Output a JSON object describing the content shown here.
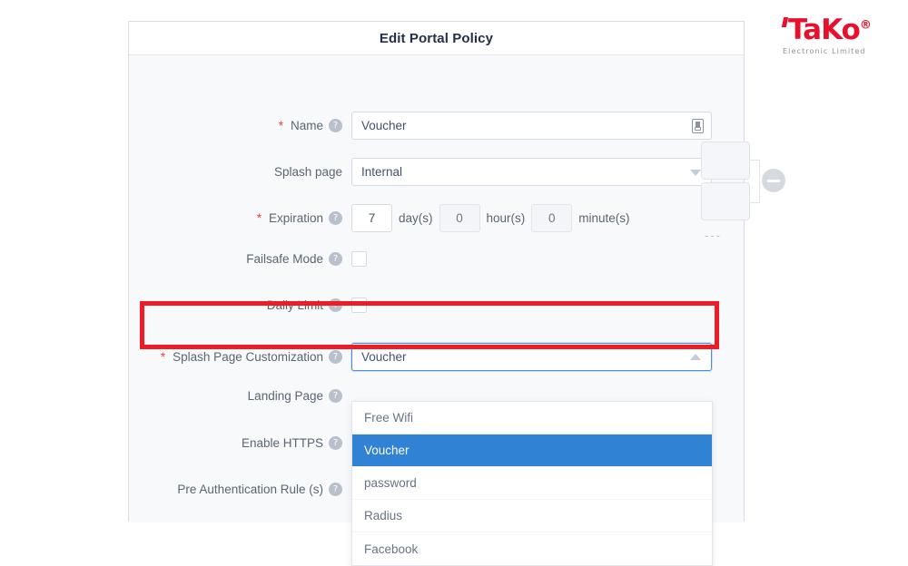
{
  "brand": {
    "wordmark": "TaKo",
    "registered": "®",
    "subtitle": "Electronic  Limited",
    "color": "#e8112d"
  },
  "panel": {
    "title": "Edit Portal Policy"
  },
  "form": {
    "name": {
      "label": "Name",
      "required": true,
      "value": "Voucher",
      "placeholder": "",
      "badge_icon": "document-badge-icon"
    },
    "splash_page": {
      "label": "Splash page",
      "required": false,
      "value": "Internal",
      "caret_icon": "chevron-down-icon"
    },
    "expiration": {
      "label": "Expiration",
      "required": true,
      "days_value": "7",
      "days_unit": "day(s)",
      "hours_value": "0",
      "hours_unit": "hour(s)",
      "minutes_value": "0",
      "minutes_unit": "minute(s)"
    },
    "failsafe_mode": {
      "label": "Failsafe Mode",
      "required": false,
      "checked": false
    },
    "daily_limit": {
      "label": "Daily Limit",
      "required": false,
      "checked": false
    },
    "splash_page_customization": {
      "label": "Splash Page Customization",
      "required": true,
      "value": "Voucher",
      "expanded": true,
      "caret_icon": "chevron-up-icon",
      "options": [
        {
          "label": "Free Wifi",
          "selected": false
        },
        {
          "label": "Voucher",
          "selected": true
        },
        {
          "label": "password",
          "selected": false
        },
        {
          "label": "Radius",
          "selected": false
        },
        {
          "label": "Facebook",
          "selected": false
        }
      ]
    },
    "landing_page": {
      "label": "Landing Page",
      "required": false
    },
    "enable_https": {
      "label": "Enable HTTPS",
      "required": false
    },
    "pre_authentication_rule": {
      "label": "Pre Authentication Rule (s)",
      "required": false,
      "remove_icon": "minus-circle-icon",
      "more_indicator": "---"
    }
  },
  "colors": {
    "accent_blue": "#3083d4",
    "highlight_red": "#ee1c25",
    "required_red": "#f04134",
    "label_gray": "#5a6473",
    "panel_bg": "#f8f9fb"
  }
}
